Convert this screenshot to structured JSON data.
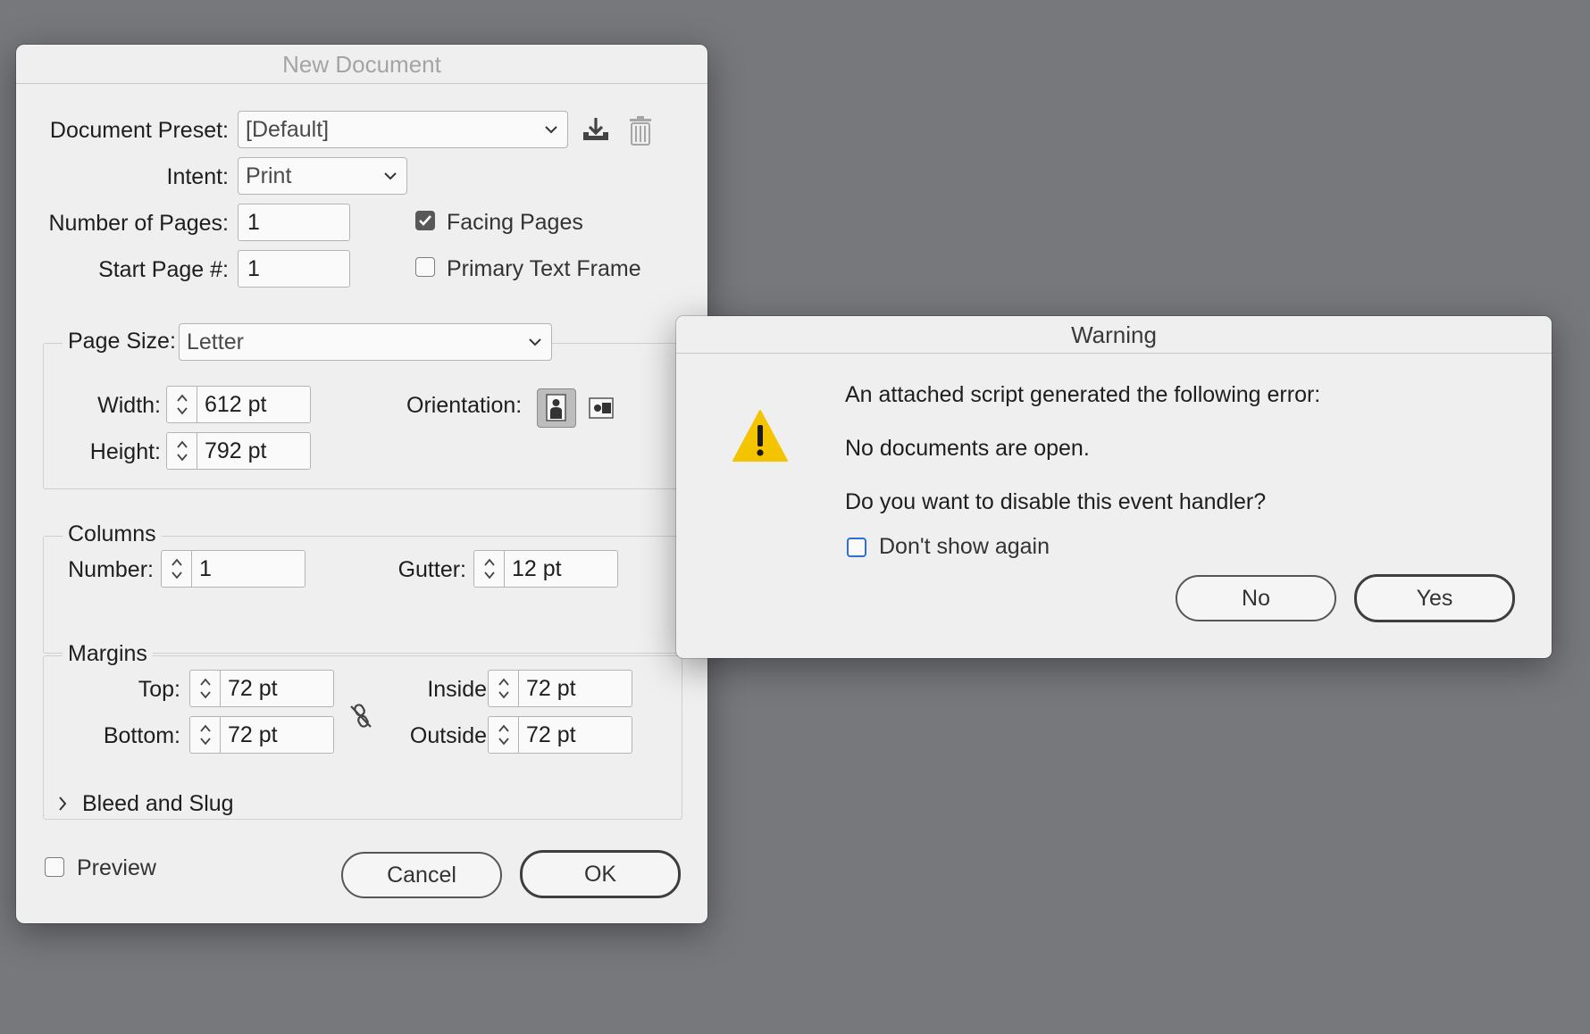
{
  "new_document": {
    "title": "New Document",
    "document_preset": {
      "label": "Document Preset:",
      "value": "[Default]"
    },
    "intent": {
      "label": "Intent:",
      "value": "Print"
    },
    "number_of_pages": {
      "label": "Number of Pages:",
      "value": "1"
    },
    "start_page": {
      "label": "Start Page #:",
      "value": "1"
    },
    "facing_pages": {
      "label": "Facing Pages",
      "checked": true
    },
    "primary_text_frame": {
      "label": "Primary Text Frame",
      "checked": false
    },
    "page_size": {
      "label": "Page Size:",
      "value": "Letter",
      "width_label": "Width:",
      "width": "612 pt",
      "height_label": "Height:",
      "height": "792 pt",
      "orientation_label": "Orientation:"
    },
    "columns": {
      "legend": "Columns",
      "number_label": "Number:",
      "number": "1",
      "gutter_label": "Gutter:",
      "gutter": "12 pt"
    },
    "margins": {
      "legend": "Margins",
      "top_label": "Top:",
      "top": "72 pt",
      "bottom_label": "Bottom:",
      "bottom": "72 pt",
      "inside_label": "Inside:",
      "inside": "72 pt",
      "outside_label": "Outside:",
      "outside": "72 pt"
    },
    "bleed_and_slug": "Bleed and Slug",
    "preview": {
      "label": "Preview",
      "checked": false
    },
    "cancel_label": "Cancel",
    "ok_label": "OK"
  },
  "warning": {
    "title": "Warning",
    "line1": "An attached script generated the following error:",
    "line2": "No documents are open.",
    "line3": "Do you want to disable this event handler?",
    "dont_show_again": {
      "label": "Don't show again",
      "checked": false
    },
    "no_label": "No",
    "yes_label": "Yes"
  },
  "colors": {
    "desktop": "#77787c",
    "dialog_bg": "#efefef",
    "warning_yellow": "#f5c400",
    "checkbox_blue": "#2f6fce"
  },
  "icons": {
    "save_preset": "download-tray-icon",
    "delete_preset": "trash-icon",
    "portrait": "portrait-orientation-icon",
    "landscape": "landscape-orientation-icon",
    "link": "broken-link-icon",
    "warning": "warning-triangle-icon",
    "disclosure": "chevron-right-icon"
  }
}
